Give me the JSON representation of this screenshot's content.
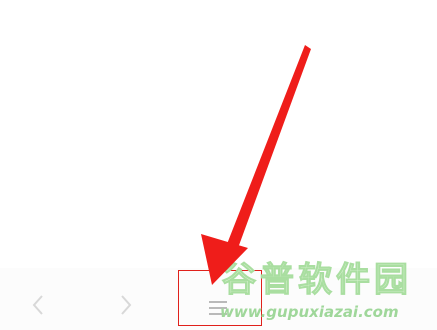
{
  "colors": {
    "background": "#ffffff",
    "navbar": "#fcfcfc",
    "nav_icon": "#d8d8d8",
    "arrow": "#ef1d1a",
    "highlight": "#e0211b",
    "watermark_text": "#d9f2d2",
    "watermark_url": "#9fd79a"
  },
  "navbar": {
    "buttons": [
      {
        "name": "back",
        "icon": "chevron-left-icon"
      },
      {
        "name": "forward",
        "icon": "chevron-right-icon"
      },
      {
        "name": "menu",
        "icon": "hamburger-menu-icon"
      }
    ]
  },
  "annotation": {
    "arrow_icon": "red-arrow-icon",
    "highlight": "red-rectangle"
  },
  "watermark": {
    "logo_text": "谷普软件园",
    "url": "www.gupuxiazai.com"
  }
}
